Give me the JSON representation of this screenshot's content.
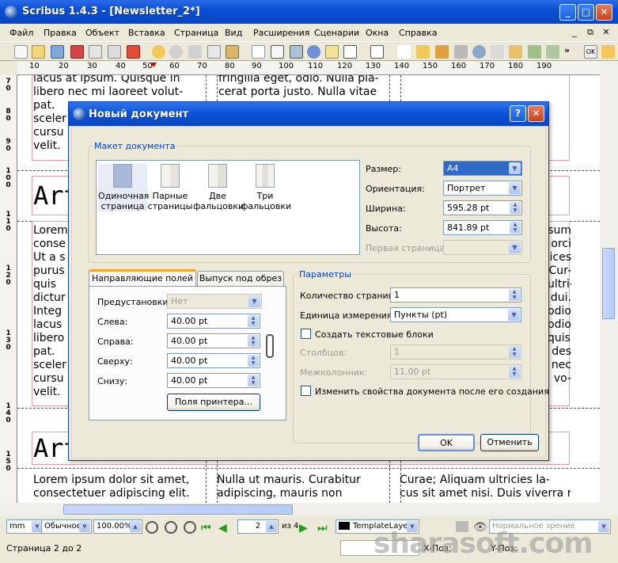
{
  "window": {
    "title": "Scribus 1.4.3 - [Newsletter_2*]"
  },
  "menu": [
    "Файл",
    "Правка",
    "Объект",
    "Вставка",
    "Страница",
    "Вид",
    "Расширения",
    "Сценарии",
    "Окна",
    "Справка"
  ],
  "ruler": {
    "h": [
      "10",
      "20",
      "30",
      "40",
      "50",
      "60",
      "70",
      "80",
      "90",
      "100",
      "110",
      "120",
      "130",
      "140",
      "150",
      "160",
      "170",
      "180",
      "190"
    ],
    "v_groups": [
      [
        "7",
        "0"
      ],
      [
        "8",
        "0"
      ],
      [
        "9",
        "0"
      ],
      [
        "1",
        "0",
        "0"
      ],
      [
        "1",
        "1",
        "0"
      ],
      [
        "1",
        "2",
        "0"
      ],
      [
        "1",
        "3",
        "0"
      ],
      [
        "1",
        "4",
        "0"
      ],
      [
        "1",
        "5",
        "0"
      ]
    ]
  },
  "document_text": {
    "row1": {
      "c1": [
        "lacus at ipsum. Quisque in",
        "libero nec mi laoreet volut-",
        "pat.",
        "sceler",
        "cursu",
        "velit."
      ],
      "c2": [
        "fringilla eget, odio. Nulla pla-",
        "cerat porta justo. Nulla vitae",
        ""
      ],
      "c3": []
    },
    "heading": "Art",
    "row2": {
      "c1": [
        "Lorem",
        "conse",
        "Ut a s",
        "purus",
        "quis",
        "dictur",
        "Integ",
        "lacus",
        "libero",
        "pat.",
        "sceler",
        "cursu",
        "velit."
      ],
      "c3": [
        "sum",
        "orci",
        "ices",
        "Cur-",
        "ultri-",
        "dui.",
        "odio",
        "odio",
        "quis,",
        "des",
        "nec",
        "vo-"
      ]
    },
    "row3": {
      "c1": [
        "Lorem ipsum dolor sit amet,",
        "consectetuer adipiscing elit."
      ],
      "c2": [
        "Nulla ut mauris. Curabitur",
        "adipiscing, mauris non"
      ],
      "c3": [
        "Curae; Aliquam ultricies la-",
        "cus sit amet nisi. Duis viverra risus"
      ]
    }
  },
  "dialog": {
    "title": "Новый документ",
    "help": "?",
    "layout_group": "Макет документа",
    "layouts": [
      {
        "label": "Одиночная страница",
        "selected": true
      },
      {
        "label": "Парные страницы",
        "selected": false
      },
      {
        "label": "Две фальцовки",
        "selected": false
      },
      {
        "label": "Три фальцовки",
        "selected": false
      }
    ],
    "size_label": "Размер:",
    "size_value": "A4",
    "orientation_label": "Ориентация:",
    "orientation_value": "Портрет",
    "width_label": "Ширина:",
    "width_value": "595.28 pt",
    "height_label": "Высота:",
    "height_value": "841.89 pt",
    "first_page_label": "Первая страница:",
    "first_page_value": "",
    "tabs": [
      "Направляющие полей",
      "Выпуск под обрез"
    ],
    "presets_label": "Предустановки:",
    "presets_value": "Нет",
    "left_label": "Слева:",
    "left_value": "40.00 pt",
    "right_label": "Справа:",
    "right_value": "40.00 pt",
    "top_label": "Сверху:",
    "top_value": "40.00 pt",
    "bottom_label": "Снизу:",
    "bottom_value": "40.00 pt",
    "printer_margins": "Поля принтера...",
    "params_group": "Параметры",
    "pages_label": "Количество страниц:",
    "pages_value": "1",
    "unit_label": "Единица измерения:",
    "unit_value": "Пункты (pt)",
    "text_frames": "Создать текстовые блоки",
    "columns_label": "Столбцов:",
    "columns_value": "1",
    "gap_label": "Межколонник:",
    "gap_value": "11.00 pt",
    "change_after": "Изменить свойства документа после его создания",
    "ok": "OK",
    "cancel": "Отменить"
  },
  "statusbar": {
    "unit": "mm",
    "mode": "Обычное",
    "zoom": "100.00%",
    "page": "2",
    "of": "из 4",
    "layer": "TemplateLayer",
    "view": "Нормальное зрение",
    "page_status": "Страница 2 до 2",
    "x_label": "X-Поз:",
    "y_label": "Y-Поз:"
  },
  "watermark": "sharasoft.com",
  "colors": {
    "titlebar": "#0a4fd6",
    "selected_page": "#a9b7d8",
    "accent": "#0046d5"
  }
}
